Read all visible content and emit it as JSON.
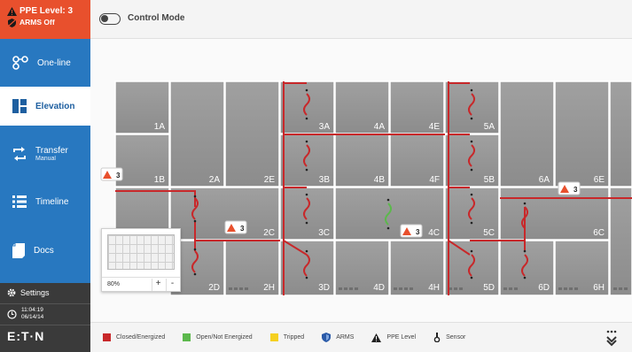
{
  "ppe_alert": {
    "level_text": "PPE Level: 3",
    "arms_text": "ARMS Off"
  },
  "nav": {
    "oneline": "One-line",
    "elevation": "Elevation",
    "transfer": "Transfer",
    "transfer_sub": "Manual",
    "timeline": "Timeline",
    "docs": "Docs"
  },
  "settings_label": "Settings",
  "clock": {
    "time": "11:04:19",
    "date": "06/14/14"
  },
  "brand": "E:T·N",
  "header": {
    "control_mode_label": "Control Mode",
    "control_mode_on": false
  },
  "elevation": {
    "cells": [
      "1A",
      "1B",
      "2A",
      "2E",
      "3A",
      "3B",
      "3C",
      "3D",
      "4A",
      "4B",
      "4C",
      "4D",
      "4E",
      "4F",
      "4H",
      "5A",
      "5B",
      "5C",
      "5D",
      "6A",
      "6E",
      "6C",
      "6D",
      "6H",
      "2C",
      "2D",
      "2H"
    ],
    "ppe_markers": [
      "3",
      "3",
      "3",
      "3"
    ]
  },
  "minimap": {
    "zoom": "80%",
    "zoom_in": "+",
    "zoom_out": "-"
  },
  "legend": [
    {
      "label": "Closed/Energized",
      "color": "#c8282a",
      "icon": "square"
    },
    {
      "label": "Open/Not Energized",
      "color": "#5cb84c",
      "icon": "square"
    },
    {
      "label": "Tripped",
      "color": "#f5d020",
      "icon": "square"
    },
    {
      "label": "ARMS",
      "color": "#2a5aa8",
      "icon": "shield-icon"
    },
    {
      "label": "PPE Level",
      "color": "#222222",
      "icon": "warning-triangle-icon"
    },
    {
      "label": "Sensor",
      "color": "#222222",
      "icon": "sensor-icon"
    }
  ],
  "colors": {
    "energized": "#c8282a",
    "open": "#5cb84c",
    "panel": "#8e8e8e",
    "sidebar": "#2878c0",
    "alert": "#e8502d"
  }
}
